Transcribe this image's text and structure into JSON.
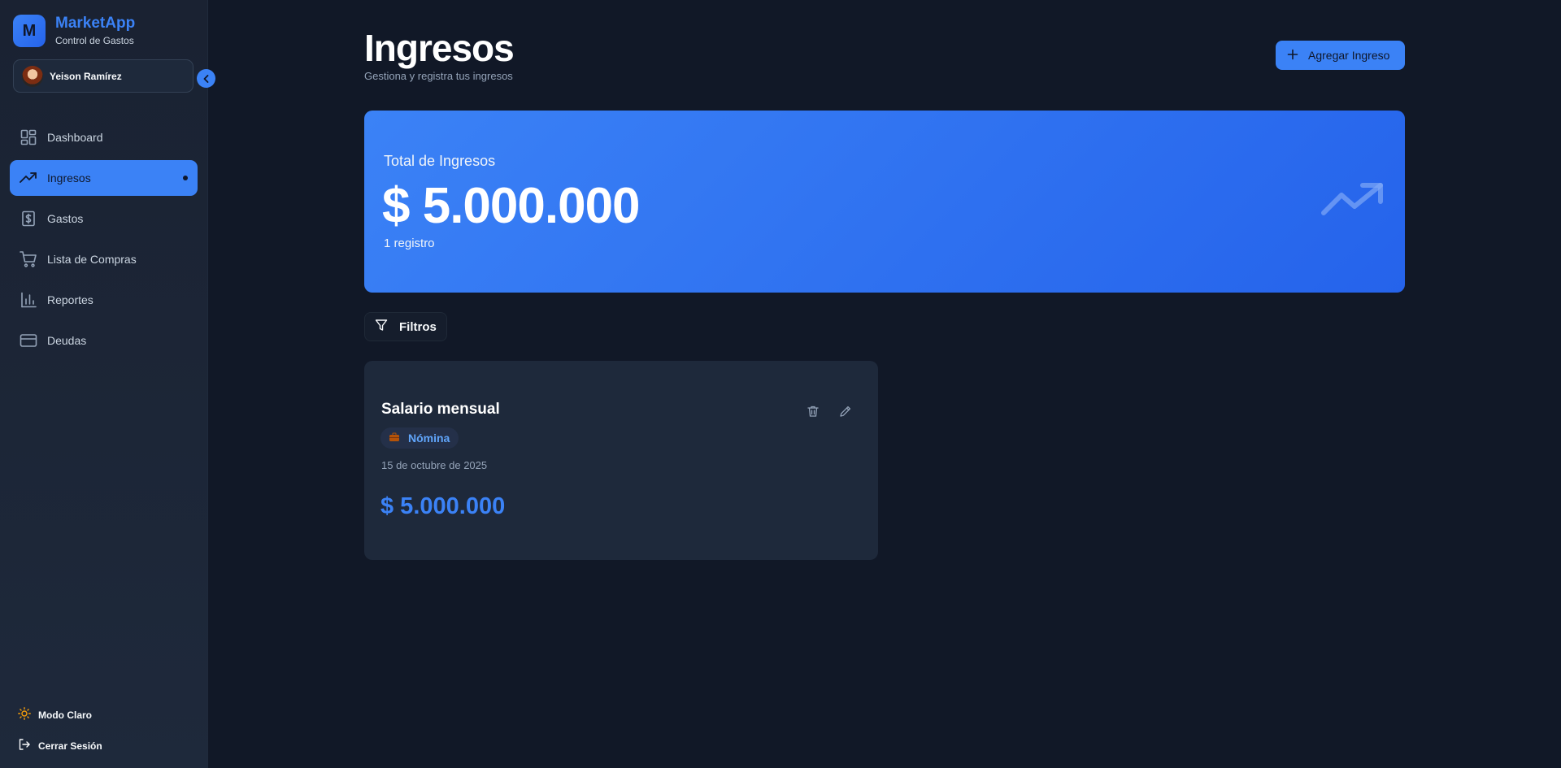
{
  "brand": {
    "initial": "M",
    "name": "MarketApp",
    "subtitle": "Control de Gastos"
  },
  "user": {
    "name": "Yeison Ramírez"
  },
  "sidebar": {
    "items": [
      {
        "label": "Dashboard",
        "icon": "dashboard-icon",
        "active": false
      },
      {
        "label": "Ingresos",
        "icon": "trending-up-icon",
        "active": true
      },
      {
        "label": "Gastos",
        "icon": "dollar-file-icon",
        "active": false
      },
      {
        "label": "Lista de Compras",
        "icon": "cart-icon",
        "active": false
      },
      {
        "label": "Reportes",
        "icon": "bar-chart-icon",
        "active": false
      },
      {
        "label": "Deudas",
        "icon": "credit-card-icon",
        "active": false
      }
    ],
    "theme_toggle": "Modo Claro",
    "logout": "Cerrar Sesión"
  },
  "header": {
    "title": "Ingresos",
    "subtitle": "Gestiona y registra tus ingresos",
    "add_button": "Agregar Ingreso"
  },
  "summary": {
    "label": "Total de Ingresos",
    "value": "$ 5.000.000",
    "count": "1 registro"
  },
  "filters": {
    "label": "Filtros"
  },
  "incomes": [
    {
      "title": "Salario mensual",
      "category": "Nómina",
      "category_icon": "briefcase-icon",
      "date": "15 de octubre de 2025",
      "amount": "$ 5.000.000"
    }
  ],
  "colors": {
    "background": "#111827",
    "sidebar": "#1e293b",
    "accent": "#3b82f6",
    "card": "#1e293b",
    "muted_text": "#94a3b8"
  }
}
